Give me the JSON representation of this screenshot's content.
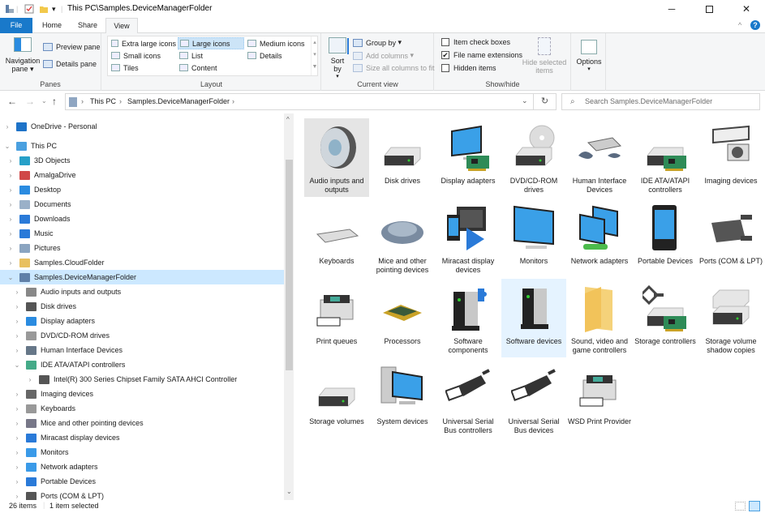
{
  "window": {
    "title": "This PC\\Samples.DeviceManagerFolder",
    "minimize_icon": "minimize-icon",
    "maximize_icon": "maximize-icon",
    "close_icon": "close-icon",
    "help_icon": "help-icon"
  },
  "tabs": [
    {
      "label": "File"
    },
    {
      "label": "Home"
    },
    {
      "label": "Share"
    },
    {
      "label": "View",
      "active": true
    }
  ],
  "ribbon": {
    "panes": {
      "label": "Panes",
      "navigation_pane": "Navigation pane",
      "preview_pane": "Preview pane",
      "details_pane": "Details pane"
    },
    "layout": {
      "label": "Layout",
      "options": [
        {
          "label": "Extra large icons"
        },
        {
          "label": "Large icons",
          "selected": true
        },
        {
          "label": "Medium icons"
        },
        {
          "label": "Small icons"
        },
        {
          "label": "List"
        },
        {
          "label": "Details"
        },
        {
          "label": "Tiles"
        },
        {
          "label": "Content"
        }
      ]
    },
    "current_view": {
      "label": "Current view",
      "sort_by": "Sort by",
      "group_by": "Group by",
      "add_columns": "Add columns",
      "size_columns": "Size all columns to fit"
    },
    "show_hide": {
      "label": "Show/hide",
      "item_check_boxes": {
        "label": "Item check boxes",
        "checked": false
      },
      "file_name_extensions": {
        "label": "File name extensions",
        "checked": true
      },
      "hidden_items": {
        "label": "Hidden items",
        "checked": false
      },
      "hide_selected": "Hide selected items",
      "check_mark": "✔"
    },
    "options": {
      "label": "Options"
    }
  },
  "address": {
    "crumbs": [
      "This PC",
      "Samples.DeviceManagerFolder"
    ],
    "separator": "›",
    "search_placeholder": "Search Samples.DeviceManagerFolder"
  },
  "tree": [
    {
      "label": "OneDrive - Personal",
      "level": 0,
      "expanded": false,
      "color": "#1e73c8"
    },
    {
      "label": "This PC",
      "level": 0,
      "expanded": true,
      "color": "#4aa0e0"
    },
    {
      "label": "3D Objects",
      "level": 1,
      "expanded": false,
      "color": "#27a0c8"
    },
    {
      "label": "AmalgaDrive",
      "level": 1,
      "expanded": false,
      "color": "#d04848"
    },
    {
      "label": "Desktop",
      "level": 1,
      "expanded": false,
      "color": "#2a8be0"
    },
    {
      "label": "Documents",
      "level": 1,
      "expanded": false,
      "color": "#9ab0c8"
    },
    {
      "label": "Downloads",
      "level": 1,
      "expanded": false,
      "color": "#2a7ad8"
    },
    {
      "label": "Music",
      "level": 1,
      "expanded": false,
      "color": "#2a7ad8"
    },
    {
      "label": "Pictures",
      "level": 1,
      "expanded": false,
      "color": "#8aa4c0"
    },
    {
      "label": "Samples.CloudFolder",
      "level": 1,
      "expanded": false,
      "color": "#e8c060"
    },
    {
      "label": "Samples.DeviceManagerFolder",
      "level": 1,
      "expanded": true,
      "selected": true,
      "color": "#6080a8"
    },
    {
      "label": "Audio inputs and outputs",
      "level": 2,
      "expanded": false,
      "color": "#888"
    },
    {
      "label": "Disk drives",
      "level": 2,
      "expanded": false,
      "color": "#555"
    },
    {
      "label": "Display adapters",
      "level": 2,
      "expanded": false,
      "color": "#2a8be0"
    },
    {
      "label": "DVD/CD-ROM drives",
      "level": 2,
      "expanded": false,
      "color": "#999"
    },
    {
      "label": "Human Interface Devices",
      "level": 2,
      "expanded": false,
      "color": "#678"
    },
    {
      "label": "IDE ATA/ATAPI controllers",
      "level": 2,
      "expanded": true,
      "color": "#4a8"
    },
    {
      "label": "Intel(R) 300 Series Chipset Family SATA AHCI Controller",
      "level": 3,
      "expanded": false,
      "color": "#555"
    },
    {
      "label": "Imaging devices",
      "level": 2,
      "expanded": false,
      "color": "#666"
    },
    {
      "label": "Keyboards",
      "level": 2,
      "expanded": false,
      "color": "#999"
    },
    {
      "label": "Mice and other pointing devices",
      "level": 2,
      "expanded": false,
      "color": "#778"
    },
    {
      "label": "Miracast display devices",
      "level": 2,
      "expanded": false,
      "color": "#2a7ad8"
    },
    {
      "label": "Monitors",
      "level": 2,
      "expanded": false,
      "color": "#3a9ae8"
    },
    {
      "label": "Network adapters",
      "level": 2,
      "expanded": false,
      "color": "#3a9ae8"
    },
    {
      "label": "Portable Devices",
      "level": 2,
      "expanded": false,
      "color": "#2a7ad8"
    },
    {
      "label": "Ports (COM & LPT)",
      "level": 2,
      "expanded": false,
      "color": "#555"
    }
  ],
  "items": [
    {
      "label": "Audio inputs and outputs",
      "icon": "speaker-icon",
      "state": "selected"
    },
    {
      "label": "Disk drives",
      "icon": "disk-drive-icon"
    },
    {
      "label": "Display adapters",
      "icon": "display-adapter-icon"
    },
    {
      "label": "DVD/CD-ROM drives",
      "icon": "dvd-drive-icon"
    },
    {
      "label": "Human Interface Devices",
      "icon": "hid-icon"
    },
    {
      "label": "IDE ATA/ATAPI controllers",
      "icon": "ide-controller-icon"
    },
    {
      "label": "Imaging devices",
      "icon": "camera-icon"
    },
    {
      "label": "Keyboards",
      "icon": "keyboard-icon"
    },
    {
      "label": "Mice and other pointing devices",
      "icon": "mouse-icon"
    },
    {
      "label": "Miracast display devices",
      "icon": "miracast-icon"
    },
    {
      "label": "Monitors",
      "icon": "monitor-icon"
    },
    {
      "label": "Network adapters",
      "icon": "network-adapter-icon"
    },
    {
      "label": "Portable Devices",
      "icon": "phone-icon"
    },
    {
      "label": "Ports (COM & LPT)",
      "icon": "port-icon"
    },
    {
      "label": "Print queues",
      "icon": "printer-icon"
    },
    {
      "label": "Processors",
      "icon": "processor-icon"
    },
    {
      "label": "Software components",
      "icon": "software-component-icon"
    },
    {
      "label": "Software devices",
      "icon": "software-device-icon",
      "state": "hover"
    },
    {
      "label": "Sound, video and game controllers",
      "icon": "folder-icon"
    },
    {
      "label": "Storage controllers",
      "icon": "storage-controller-icon"
    },
    {
      "label": "Storage volume shadow copies",
      "icon": "shadow-copy-icon"
    },
    {
      "label": "Storage volumes",
      "icon": "storage-volume-icon"
    },
    {
      "label": "System devices",
      "icon": "computer-icon"
    },
    {
      "label": "Universal Serial Bus controllers",
      "icon": "usb-icon"
    },
    {
      "label": "Universal Serial Bus devices",
      "icon": "usb-icon"
    },
    {
      "label": "WSD Print Provider",
      "icon": "printer-icon"
    }
  ],
  "status": {
    "count": "26 items",
    "selection": "1 item selected"
  }
}
